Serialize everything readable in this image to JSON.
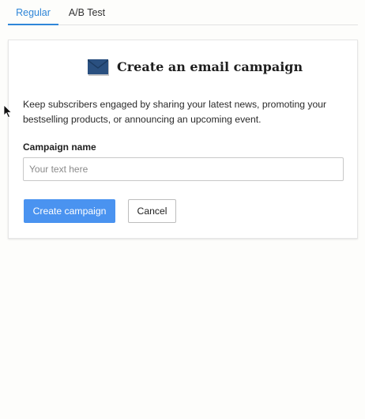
{
  "tabs": [
    {
      "label": "Regular",
      "active": true
    },
    {
      "label": "A/B Test",
      "active": false
    }
  ],
  "card": {
    "icon": "envelope-icon",
    "title": "Create an email campaign",
    "description": "Keep subscribers engaged by sharing your latest news, promoting your bestselling products, or announcing an upcoming event.",
    "field_label": "Campaign name",
    "input_placeholder": "Your text here",
    "input_value": "",
    "create_label": "Create campaign",
    "cancel_label": "Cancel"
  },
  "colors": {
    "accent": "#2f86d8",
    "primary_button": "#4a93f0",
    "envelope": "#2a5080"
  }
}
